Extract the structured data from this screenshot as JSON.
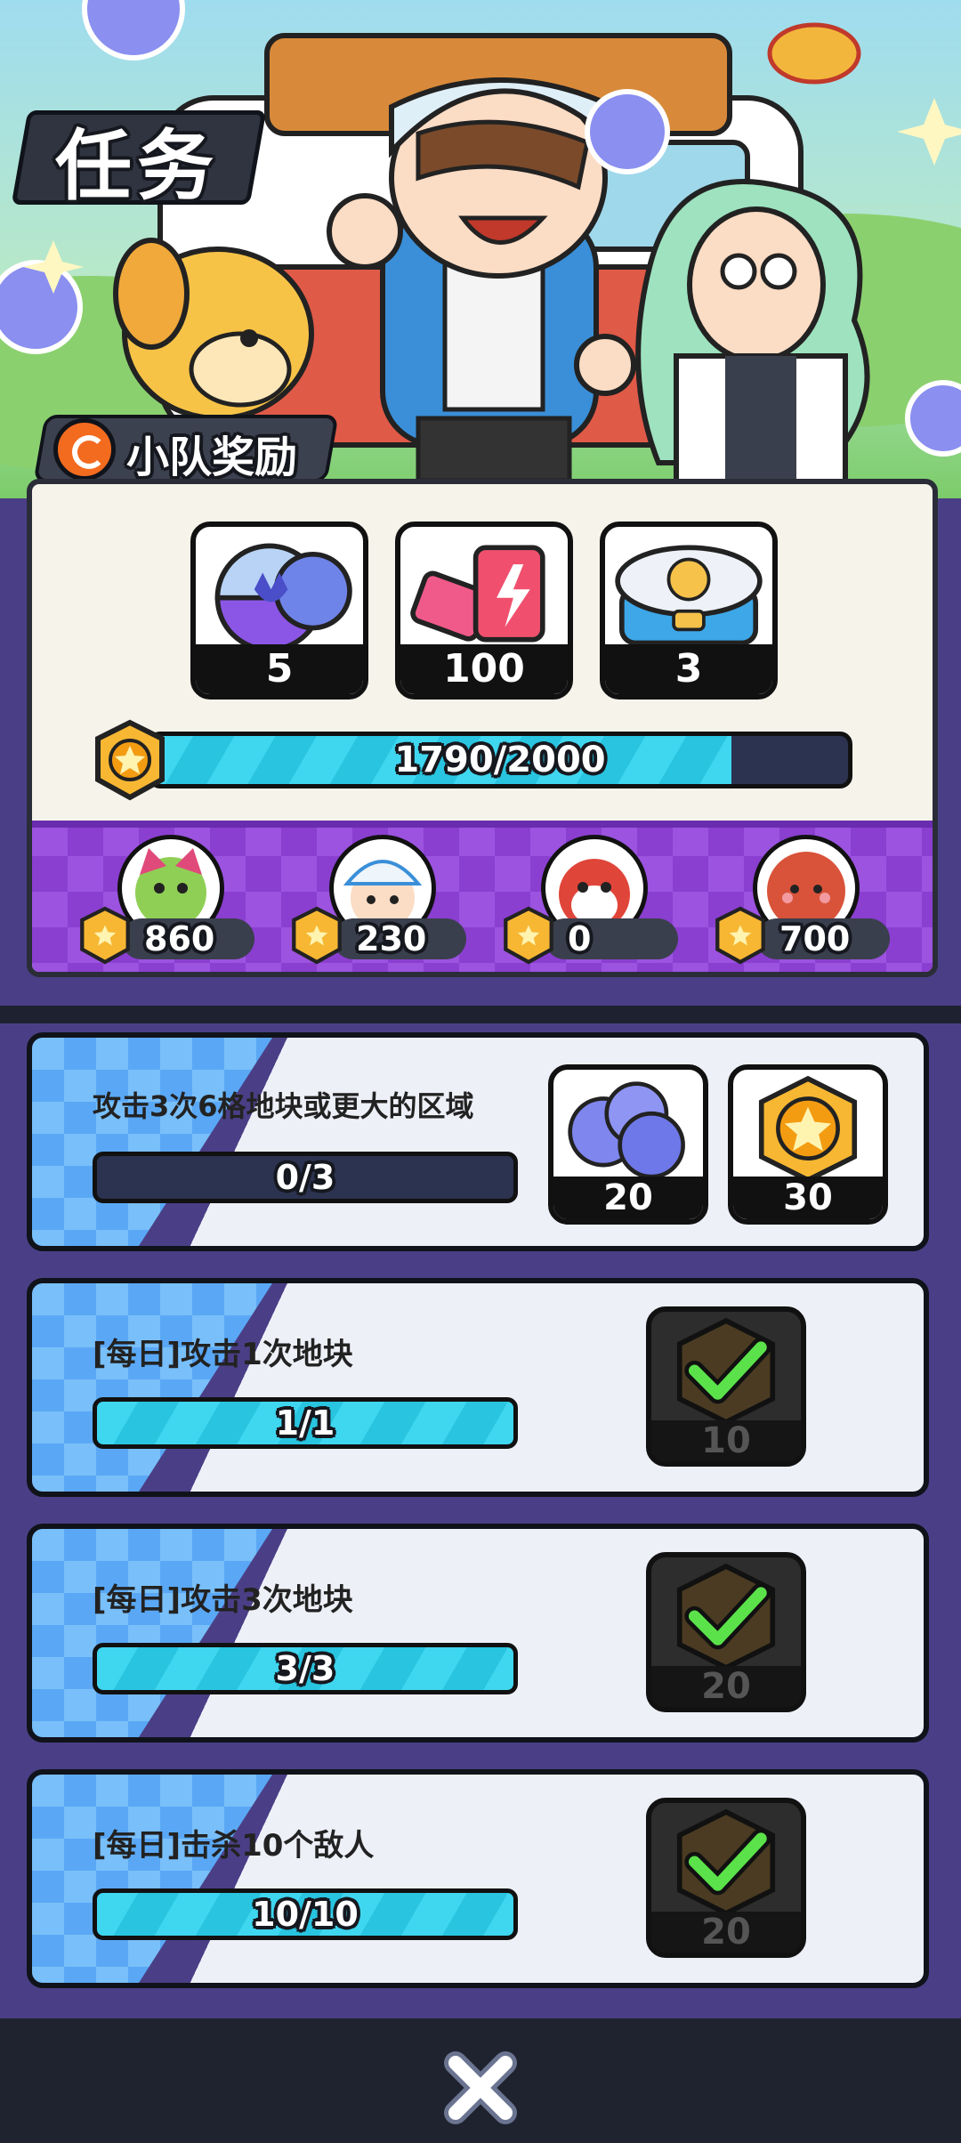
{
  "page": {
    "title": "任务"
  },
  "squad": {
    "label": "小队奖励",
    "rewards": [
      {
        "icon": "capsule-icon",
        "qty": "5"
      },
      {
        "icon": "energy-can-icon",
        "qty": "100"
      },
      {
        "icon": "lunchbox-icon",
        "qty": "3"
      }
    ],
    "progress": {
      "text": "1790/2000",
      "value": 1790,
      "max": 2000
    },
    "members": [
      {
        "avatar": "cat-avatar",
        "points": "860"
      },
      {
        "avatar": "boy-avatar",
        "points": "230"
      },
      {
        "avatar": "hamster-avatar",
        "points": "0"
      },
      {
        "avatar": "blob-avatar",
        "points": "700"
      }
    ]
  },
  "tasks": [
    {
      "name": "攻击3次6格地块或更大的区域",
      "progress_text": "0/3",
      "value": 0,
      "max": 3,
      "rewards": [
        {
          "icon": "orb-icon",
          "qty": "20"
        },
        {
          "icon": "star-badge-icon",
          "qty": "30"
        }
      ],
      "claimed": false
    },
    {
      "name": "[每日]攻击1次地块",
      "progress_text": "1/1",
      "value": 1,
      "max": 1,
      "reward_qty": "10",
      "claimed": true
    },
    {
      "name": "[每日]攻击3次地块",
      "progress_text": "3/3",
      "value": 3,
      "max": 3,
      "reward_qty": "20",
      "claimed": true
    },
    {
      "name": "[每日]击杀10个敌人",
      "progress_text": "10/10",
      "value": 10,
      "max": 10,
      "reward_qty": "20",
      "claimed": true
    }
  ],
  "colors": {
    "accent": "#3fd6ef",
    "panel": "#f6f3ea",
    "purple": "#8a3fd0",
    "check": "#5be24a"
  }
}
